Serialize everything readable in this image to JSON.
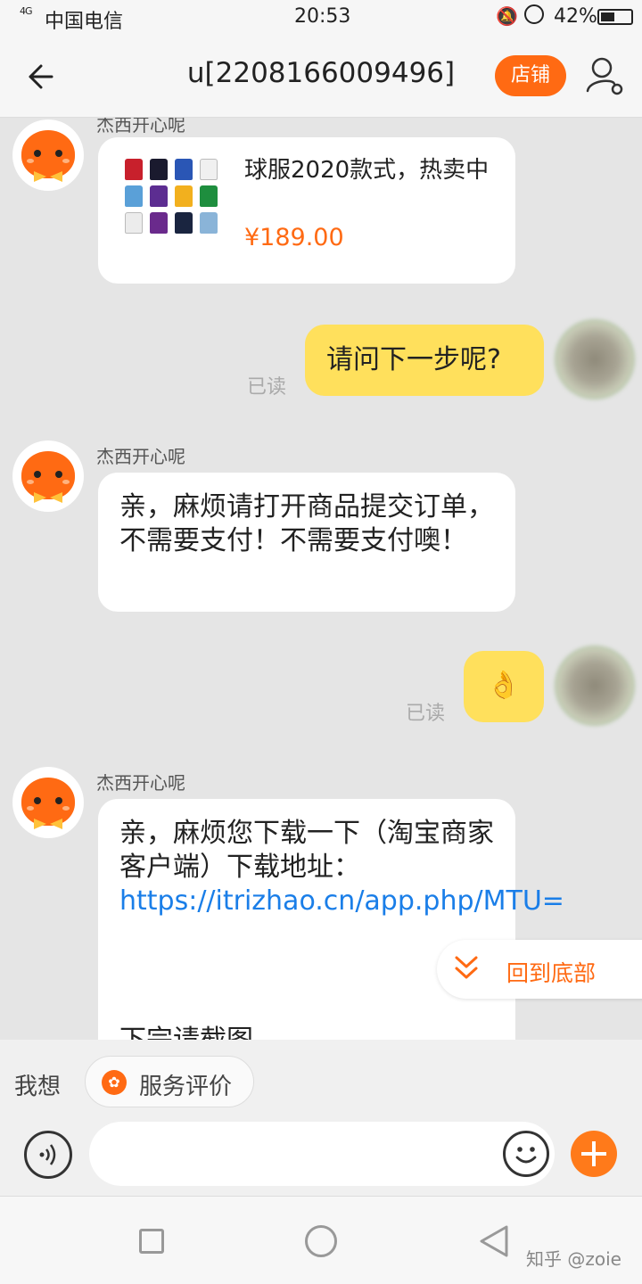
{
  "status_bar": {
    "signal": "4G",
    "carrier": "中国电信",
    "time": "20:53",
    "battery": "42%",
    "battery_level": 0.42
  },
  "header": {
    "title": "u[2208166009496]",
    "shop_label": "店铺"
  },
  "messages": [
    {
      "sender": "杰西开心呢",
      "type": "product-card",
      "product_title": "球服2020款式，热卖中",
      "price": "¥189.00"
    },
    {
      "type": "mine",
      "text": "请问下一步呢?",
      "read": "已读"
    },
    {
      "sender": "杰西开心呢",
      "type": "text",
      "text": "亲，麻烦请打开商品提交订单，不需要支付！不需要支付噢！"
    },
    {
      "type": "mine",
      "text": "👌",
      "read": "已读"
    },
    {
      "sender": "杰西开心呢",
      "type": "text",
      "text_prefix": "亲，麻烦您下载一下（淘宝商家客户端）下载地址：",
      "link": "https://itrizhao.cn/app.php/MTU=",
      "text_suffix": "下完请截图"
    }
  ],
  "scroll_to_bottom": "回到底部",
  "service_bar": {
    "want_label": "我想",
    "evaluate_label": "服务评价"
  },
  "input": {
    "placeholder": ""
  },
  "watermark": "知乎 @zoie",
  "colors": {
    "accent": "#ff6a13",
    "my_bubble": "#ffe05c",
    "link": "#1a7ee8",
    "background": "#e5e5e5"
  }
}
